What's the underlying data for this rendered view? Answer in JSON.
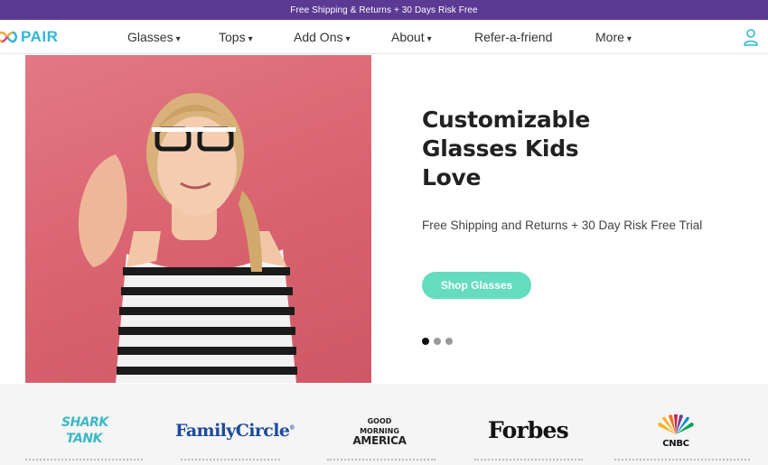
{
  "promo": {
    "text": "Free Shipping & Returns + 30 Days Risk Free"
  },
  "brand": {
    "name": "PAIR",
    "accent_color": "#2fb9d4"
  },
  "nav": {
    "items": [
      {
        "label": "Glasses",
        "has_dropdown": true
      },
      {
        "label": "Tops",
        "has_dropdown": true
      },
      {
        "label": "Add Ons",
        "has_dropdown": true
      },
      {
        "label": "About",
        "has_dropdown": true
      },
      {
        "label": "Refer-a-friend",
        "has_dropdown": false
      },
      {
        "label": "More",
        "has_dropdown": true
      }
    ],
    "caret": "▾",
    "account_icon": "user-icon"
  },
  "hero": {
    "title_lines": [
      "Customizable",
      "Glasses Kids",
      "Love"
    ],
    "subtitle": "Free Shipping and Returns + 30 Day Risk Free Trial",
    "cta_label": "Shop Glasses",
    "cta_color": "#65dcc0",
    "background_color": "#d9626f",
    "slides_total": 3,
    "slide_active": 1
  },
  "press": {
    "logos": [
      {
        "name": "shark-tank-logo",
        "line1": "SHARK",
        "line2": "TANK"
      },
      {
        "name": "family-circle-logo",
        "text": "FamilyCircle"
      },
      {
        "name": "good-morning-america-logo",
        "line1": "GOOD",
        "line2": "MORNING",
        "line3": "AMERICA"
      },
      {
        "name": "forbes-logo",
        "text": "Forbes"
      },
      {
        "name": "cnbc-logo",
        "text": "CNBC"
      }
    ]
  },
  "colors": {
    "promo_bg": "#5b3a93",
    "press_bg": "#f5f5f5"
  }
}
